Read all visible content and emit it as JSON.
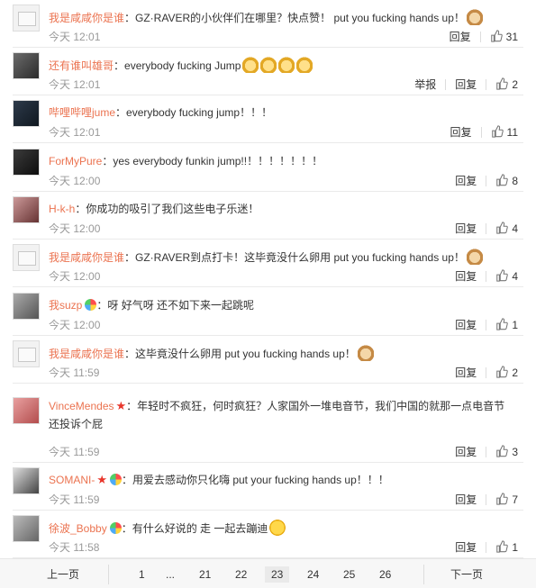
{
  "comments": [
    {
      "user": "我是咸咸你是谁",
      "text": "：GZ·RAVER的小伙伴们在哪里？快点赞！ put you fucking hands up！",
      "emoji": "dog",
      "time": "今天 12:01",
      "report": "",
      "reply": "回复",
      "likes": "31"
    },
    {
      "user": "还有谁叫雄哥",
      "text": "：everybody fucking Jump",
      "emoji": "dog4",
      "time": "今天 12:01",
      "report": "举报",
      "reply": "回复",
      "likes": "2"
    },
    {
      "user": "哔哩哔哩jume",
      "text": "：everybody fucking jump！！！",
      "emoji": "",
      "time": "今天 12:01",
      "report": "",
      "reply": "回复",
      "likes": "11"
    },
    {
      "user": "ForMyPure",
      "text": "：yes everybody funkin jump!!！！！！！！！",
      "emoji": "",
      "time": "今天 12:00",
      "report": "",
      "reply": "回复",
      "likes": "8"
    },
    {
      "user": "H-k-h",
      "text": "：你成功的吸引了我们这些电子乐迷！",
      "emoji": "",
      "time": "今天 12:00",
      "report": "",
      "reply": "回复",
      "likes": "4"
    },
    {
      "user": "我是咸咸你是谁",
      "text": "：GZ·RAVER到点打卡！这毕竟没什么卵用 put you fucking hands up！",
      "emoji": "dog",
      "time": "今天 12:00",
      "report": "",
      "reply": "回复",
      "likes": "4"
    },
    {
      "user": "我suzp",
      "text": "：呀 好气呀 还不如下来一起跳呢",
      "emoji": "",
      "badge": true,
      "time": "今天 12:00",
      "report": "",
      "reply": "回复",
      "likes": "1"
    },
    {
      "user": "我是咸咸你是谁",
      "text": "：这毕竟没什么卵用 put you fucking hands up！",
      "emoji": "dog",
      "time": "今天 11:59",
      "report": "",
      "reply": "回复",
      "likes": "2"
    },
    {
      "user": "VinceMendes",
      "text": "：年轻时不疯狂，何时疯狂？人家国外一堆电音节，我们中国的就那一点电音节还投诉个屁",
      "emoji": "",
      "star": true,
      "time": "今天 11:59",
      "report": "",
      "reply": "回复",
      "likes": "3"
    },
    {
      "user": "SOMANI-",
      "text": "：用爱去感动你只化嗨 put your fucking hands up！！！",
      "emoji": "",
      "star": true,
      "badge": true,
      "time": "今天 11:59",
      "report": "",
      "reply": "回复",
      "likes": "7"
    },
    {
      "user": "徐波_Bobby",
      "text": "：有什么好说的 走 一起去蹦迪",
      "emoji": "laugh",
      "badge": true,
      "time": "今天 11:58",
      "report": "",
      "reply": "回复",
      "likes": "1"
    }
  ],
  "pager": {
    "prev": "上一页",
    "pages": [
      "1",
      "...",
      "21",
      "22",
      "23",
      "24",
      "25",
      "26"
    ],
    "current": "23",
    "next": "下一页"
  },
  "colors": {
    "username": "#eb7350",
    "meta": "#999999",
    "pager_bg": "#f7f7f7"
  }
}
